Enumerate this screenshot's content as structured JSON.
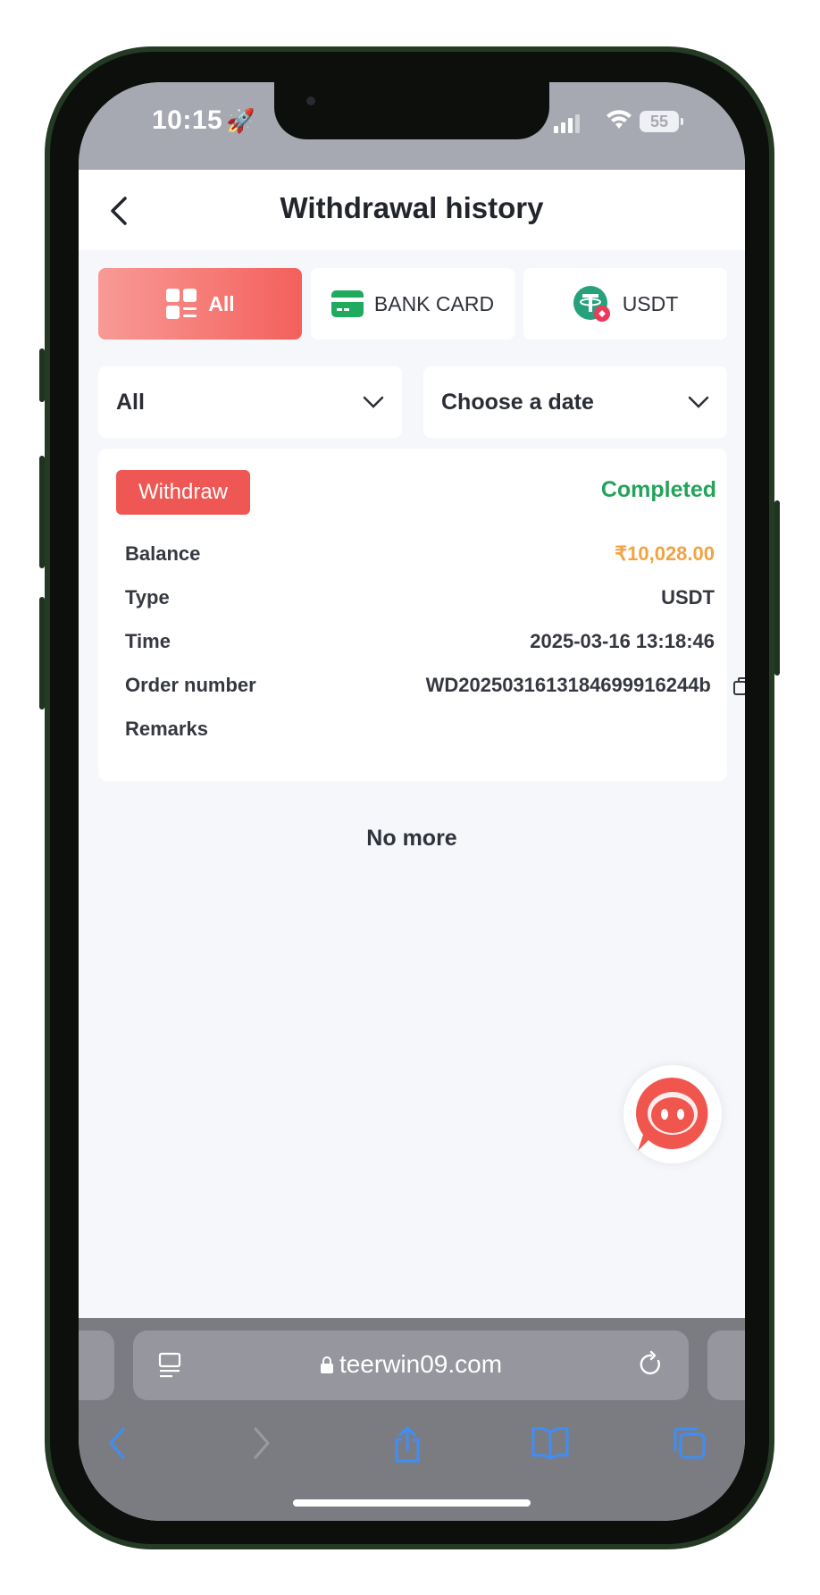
{
  "status_bar": {
    "time": "10:15",
    "battery": "55"
  },
  "header": {
    "title": "Withdrawal history"
  },
  "tabs": [
    {
      "label": "All",
      "active": true
    },
    {
      "label": "BANK CARD",
      "active": false
    },
    {
      "label": "USDT",
      "active": false
    }
  ],
  "filters": {
    "type": "All",
    "date": "Choose a date"
  },
  "record": {
    "badge": "Withdraw",
    "status": "Completed",
    "rows": [
      {
        "label": "Balance",
        "value": "₹10,028.00"
      },
      {
        "label": "Type",
        "value": "USDT"
      },
      {
        "label": "Time",
        "value": "2025-03-16 13:18:46"
      },
      {
        "label": "Order number",
        "value": "WD2025031613184699916244b"
      },
      {
        "label": "Remarks",
        "value": ""
      }
    ]
  },
  "footer_text": "No more",
  "browser": {
    "url": "teerwin09.com"
  },
  "colors": {
    "accent": "#f4605c",
    "success": "#24a35a",
    "money": "#f2a342",
    "badge": "#ee5753"
  }
}
